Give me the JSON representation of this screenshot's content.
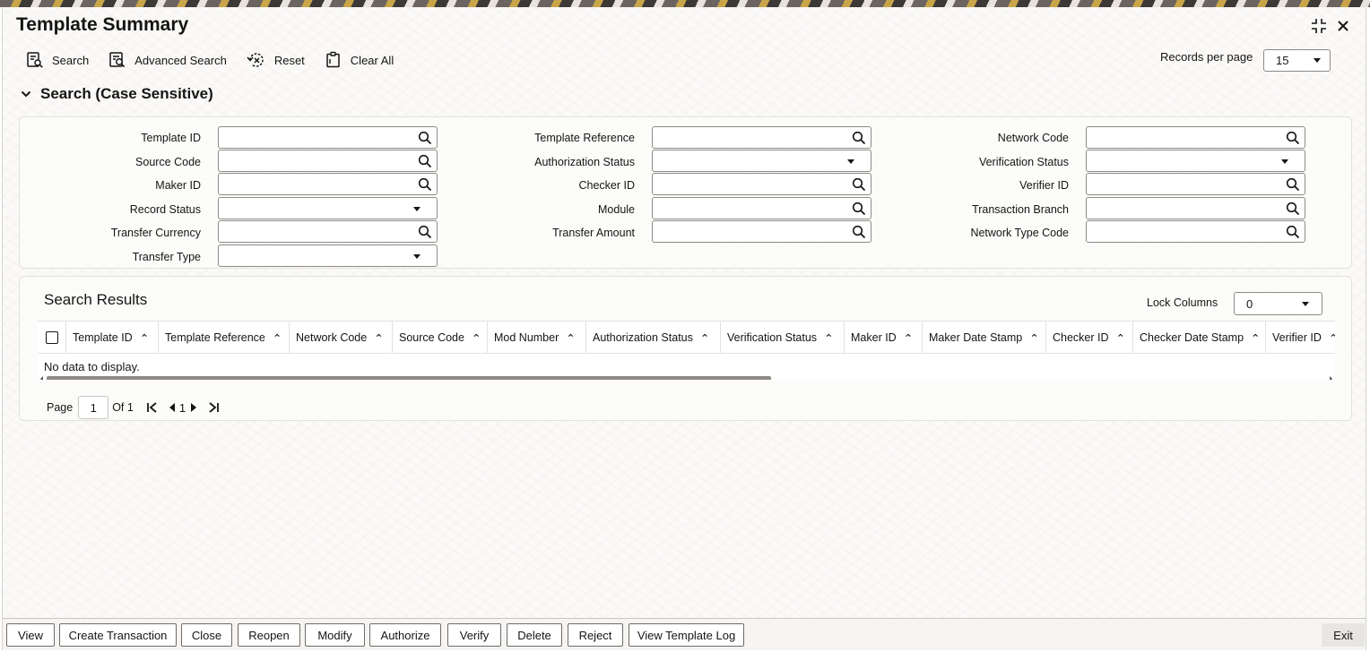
{
  "window": {
    "title": "Template Summary"
  },
  "toolbar": {
    "search": "Search",
    "advanced_search": "Advanced Search",
    "reset": "Reset",
    "clear_all": "Clear All",
    "records_per_page_label": "Records per page",
    "records_per_page_value": "15"
  },
  "search_section": {
    "title": "Search (Case Sensitive)",
    "fields": {
      "template_id": "Template ID",
      "source_code": "Source Code",
      "maker_id": "Maker ID",
      "record_status": "Record Status",
      "transfer_currency": "Transfer Currency",
      "transfer_type": "Transfer Type",
      "template_reference": "Template Reference",
      "authorization_status": "Authorization Status",
      "checker_id": "Checker ID",
      "module": "Module",
      "transfer_amount": "Transfer Amount",
      "network_code": "Network Code",
      "verification_status": "Verification Status",
      "verifier_id": "Verifier ID",
      "transaction_branch": "Transaction Branch",
      "network_type_code": "Network Type Code"
    }
  },
  "results": {
    "title": "Search Results",
    "lock_columns_label": "Lock Columns",
    "lock_columns_value": "0",
    "columns": [
      "Template ID",
      "Template Reference",
      "Network Code",
      "Source Code",
      "Mod Number",
      "Authorization Status",
      "Verification Status",
      "Maker ID",
      "Maker Date Stamp",
      "Checker ID",
      "Checker Date Stamp",
      "Verifier ID"
    ],
    "empty_message": "No data to display.",
    "pager": {
      "page_label": "Page",
      "current_page": "1",
      "of_label": "Of 1",
      "nav_page": "1"
    }
  },
  "actions": {
    "view": "View",
    "create_transaction": "Create Transaction",
    "close": "Close",
    "reopen": "Reopen",
    "modify": "Modify",
    "authorize": "Authorize",
    "verify": "Verify",
    "delete": "Delete",
    "reject": "Reject",
    "view_template_log": "View Template Log",
    "exit": "Exit"
  }
}
